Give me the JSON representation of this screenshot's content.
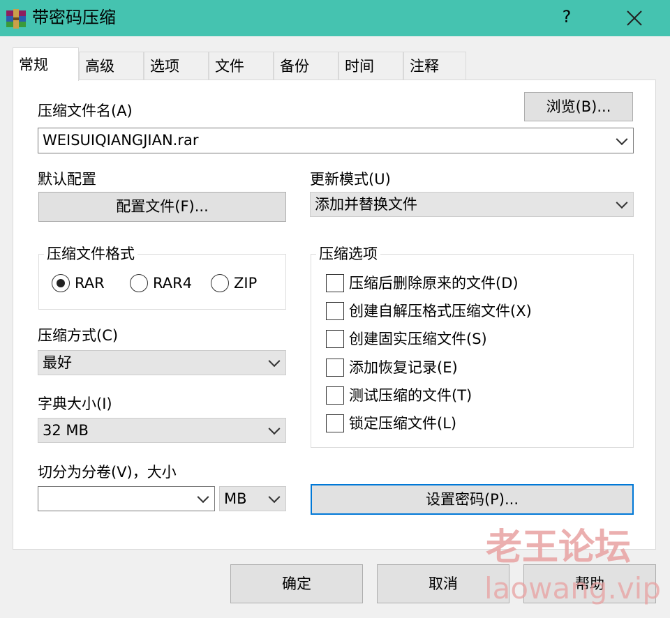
{
  "window": {
    "title": "带密码压缩",
    "help_glyph": "?"
  },
  "tabs": [
    "常规",
    "高级",
    "选项",
    "文件",
    "备份",
    "时间",
    "注释"
  ],
  "archive_name": {
    "label": "压缩文件名(A)",
    "value": "WEISUIQIANGJIAN.rar",
    "browse_label": "浏览(B)..."
  },
  "default_profile": {
    "label": "默认配置",
    "button_label": "配置文件(F)..."
  },
  "update_mode": {
    "label": "更新模式(U)",
    "value": "添加并替换文件"
  },
  "archive_format": {
    "label": "压缩文件格式",
    "options": [
      "RAR",
      "RAR4",
      "ZIP"
    ],
    "selected": "RAR"
  },
  "compression_method": {
    "label": "压缩方式(C)",
    "value": "最好"
  },
  "dictionary_size": {
    "label": "字典大小(I)",
    "value": "32 MB"
  },
  "split_volumes": {
    "label": "切分为分卷(V)，大小",
    "value": "",
    "unit": "MB"
  },
  "archive_options": {
    "label": "压缩选项",
    "items": [
      {
        "label": "压缩后删除原来的文件(D)",
        "checked": false
      },
      {
        "label": "创建自解压格式压缩文件(X)",
        "checked": false
      },
      {
        "label": "创建固实压缩文件(S)",
        "checked": false
      },
      {
        "label": "添加恢复记录(E)",
        "checked": false
      },
      {
        "label": "测试压缩的文件(T)",
        "checked": false
      },
      {
        "label": "锁定压缩文件(L)",
        "checked": false
      }
    ]
  },
  "set_password_label": "设置密码(P)...",
  "footer": {
    "ok": "确定",
    "cancel": "取消",
    "help": "帮助"
  },
  "watermark": {
    "line1": "老王论坛",
    "line2": "laowang.vip"
  },
  "colors": {
    "titlebar": "#45c3b0",
    "focus_border": "#0078d7",
    "watermark": "#e8a2a2"
  }
}
